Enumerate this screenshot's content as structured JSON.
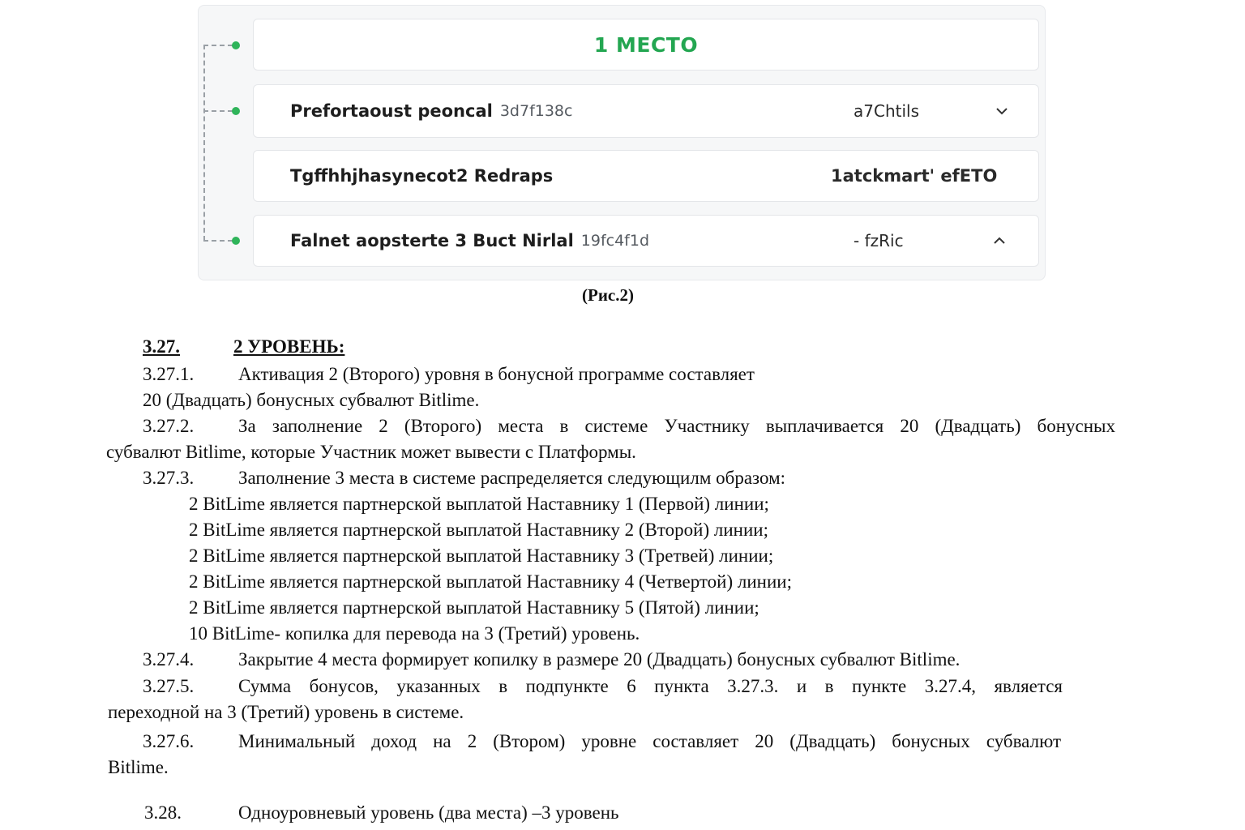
{
  "figure": {
    "header": "1 МЕСТО",
    "rows": [
      {
        "name": "Prefortaoust peoncal",
        "id": "3d7f138c",
        "value": "a7Chtils",
        "chevron": "chevron-down-icon"
      },
      {
        "name": "Tgffhhjhasynecot2 Redraps",
        "id": "",
        "value": "1atckmart' efETO",
        "chevron": ""
      },
      {
        "name": "Falnet aopsterte 3 Buct Nirlal",
        "id": "19fc4f1d",
        "value": "- fzRic",
        "chevron": "chevron-up-icon"
      }
    ],
    "caption": "(Рис.2)",
    "accent_color": "#23a651"
  },
  "doc": {
    "s3_27": {
      "num": "3.27.",
      "title": "2 УРОВЕНЬ:"
    },
    "p1": {
      "num": "3.27.1.",
      "line1": "Активация 2 (Второго) уровня в бонусной программе составляет",
      "line2": "20 (Двадцать) бонусных субвалют Bitlime."
    },
    "p2": {
      "num": "3.27.2.",
      "line1": "За заполнение 2 (Второго) места в системе Участнику выплачивается 20 (Двадцать) бонусных",
      "line2": "субвалют Bitlime, которые Участник может вывести с Платформы."
    },
    "p3": {
      "num": "3.27.3.",
      "line1": "Заполнение 3 места в системе распределяется следующилм образом:",
      "items": [
        "2 BitLime является партнерской выплатой Наставнику 1 (Первой) линии;",
        "2 BitLime является партнерской выплатой Наставнику 2 (Второй) линии;",
        "2 BitLime является партнерской выплатой Наставнику 3 (Третвей) линии;",
        "2 BitLime является партнерской выплатой Наставнику 4 (Четвертой) линии;",
        "2 BitLime является партнерской выплатой Наставнику 5 (Пятой) линии;",
        "10 BitLime- копилка для перевода на 3 (Третий) уровень."
      ]
    },
    "p4": {
      "num": "3.27.4.",
      "line1": "Закрытие 4 места формирует копилку в размере 20 (Двадцать) бонусных субвалют Bitlime."
    },
    "p5": {
      "num": "3.27.5.",
      "line1": "Сумма бонусов, указанных в подпункте 6 пункта 3.27.3. и в пункте 3.27.4, является",
      "line2": "переходной на 3 (Третий) уровень в системе."
    },
    "p6": {
      "num": "3.27.6.",
      "line1": "Минимальный доход на 2 (Втором) уровне составляет 20 (Двадцать) бонусных субвалют",
      "line2": "Bitlime."
    },
    "s3_28": {
      "num": "3.28.",
      "line1": "Одноуровневый уровень (два места) –3 уровень"
    }
  }
}
